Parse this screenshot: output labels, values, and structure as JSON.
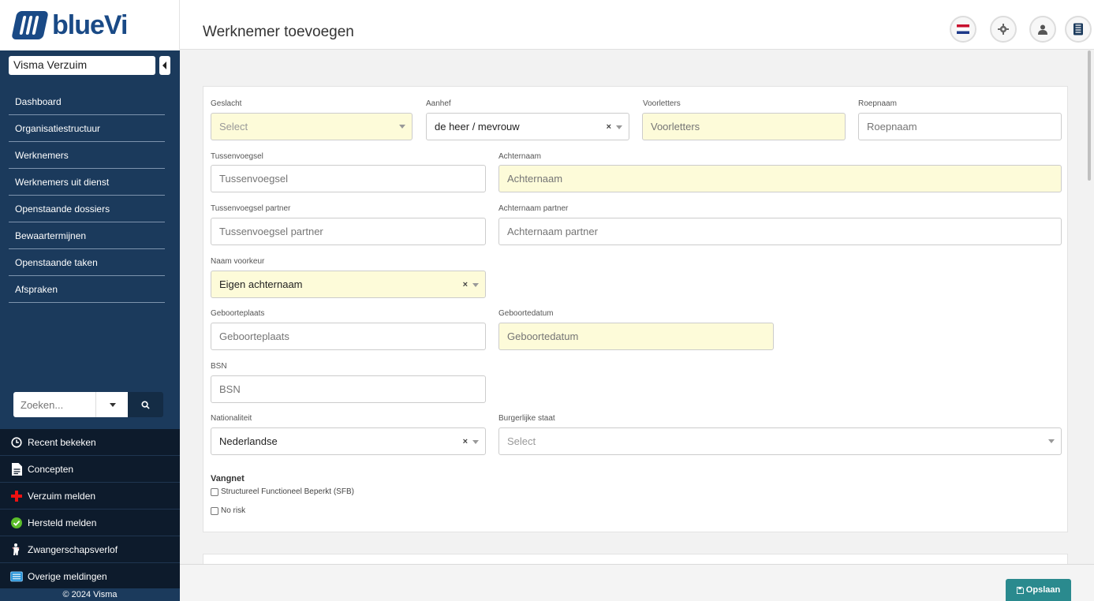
{
  "app": {
    "logo_text": "blueVi",
    "colors": {
      "brand": "#1a4a86",
      "sidebar": "#1b3a5c",
      "sidebar_dark": "#0d1b2c",
      "required_bg": "#fdfbd9",
      "save_button": "#2a8a8e"
    }
  },
  "sidebar": {
    "org_select": "Visma Verzuim",
    "nav": [
      {
        "label": "Dashboard"
      },
      {
        "label": "Organisatiestructuur"
      },
      {
        "label": "Werknemers"
      },
      {
        "label": "Werknemers uit dienst"
      },
      {
        "label": "Openstaande dossiers"
      },
      {
        "label": "Bewaartermijnen"
      },
      {
        "label": "Openstaande taken"
      },
      {
        "label": "Afspraken"
      }
    ],
    "search_placeholder": "Zoeken...",
    "quick_links": [
      {
        "label": "Recent bekeken",
        "icon": "clock-icon"
      },
      {
        "label": "Concepten",
        "icon": "document-icon"
      },
      {
        "label": "Verzuim melden",
        "icon": "red-cross-icon"
      },
      {
        "label": "Hersteld melden",
        "icon": "check-circle-icon"
      },
      {
        "label": "Zwangerschapsverlof",
        "icon": "pregnant-person-icon"
      },
      {
        "label": "Overige meldingen",
        "icon": "list-icon"
      }
    ],
    "copyright": "© 2024 Visma"
  },
  "header": {
    "title": "Werknemer toevoegen",
    "icons": [
      "dutch-flag-icon",
      "gear-icon",
      "user-icon",
      "building-icon"
    ]
  },
  "form": {
    "geslacht": {
      "label": "Geslacht",
      "placeholder": "Select"
    },
    "aanhef": {
      "label": "Aanhef",
      "value": "de heer / mevrouw"
    },
    "voorletters": {
      "label": "Voorletters",
      "placeholder": "Voorletters"
    },
    "roepnaam": {
      "label": "Roepnaam",
      "placeholder": "Roepnaam"
    },
    "tussenvoegsel": {
      "label": "Tussenvoegsel",
      "placeholder": "Tussenvoegsel"
    },
    "achternaam": {
      "label": "Achternaam",
      "placeholder": "Achternaam"
    },
    "tussenvoegsel_partner": {
      "label": "Tussenvoegsel partner",
      "placeholder": "Tussenvoegsel partner"
    },
    "achternaam_partner": {
      "label": "Achternaam partner",
      "placeholder": "Achternaam partner"
    },
    "naam_voorkeur": {
      "label": "Naam voorkeur",
      "value": "Eigen achternaam"
    },
    "geboorteplaats": {
      "label": "Geboorteplaats",
      "placeholder": "Geboorteplaats"
    },
    "geboortedatum": {
      "label": "Geboortedatum",
      "placeholder": "Geboortedatum"
    },
    "bsn": {
      "label": "BSN",
      "placeholder": "BSN"
    },
    "nationaliteit": {
      "label": "Nationaliteit",
      "value": "Nederlandse"
    },
    "burgerlijke_staat": {
      "label": "Burgerlijke staat",
      "placeholder": "Select"
    },
    "vangnet": {
      "title": "Vangnet",
      "options": [
        {
          "label": "Structureel Functioneel Beperkt (SFB)",
          "checked": false
        },
        {
          "label": "No risk",
          "checked": false
        }
      ]
    }
  },
  "footer": {
    "save_label": "Opslaan"
  }
}
